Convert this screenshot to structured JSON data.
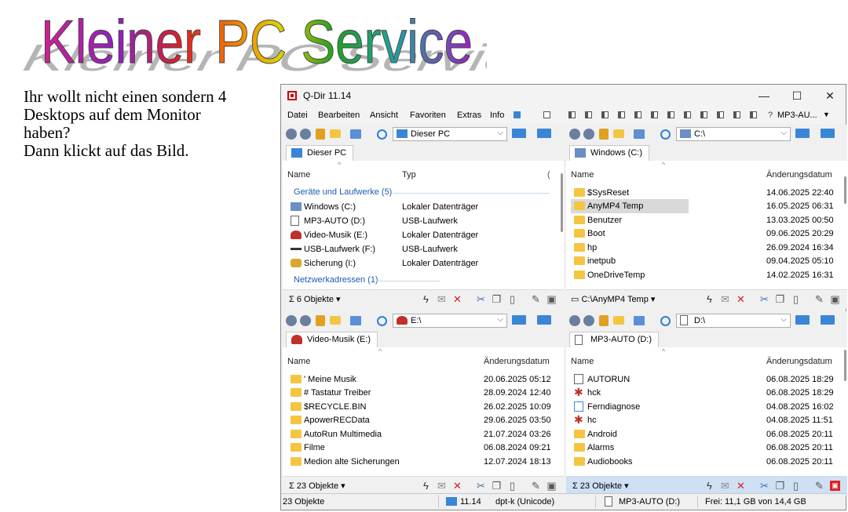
{
  "banner": {
    "text": "Kleiner PC Service"
  },
  "intro": {
    "lines": [
      "Ihr wollt nicht einen sondern 4",
      "Desktops auf dem Monitor",
      "haben?",
      "Dann klickt auf das Bild."
    ]
  },
  "window": {
    "title": "Q-Dir 11.14",
    "controls": {
      "minimize": "—",
      "maximize": "☐",
      "close": "✕"
    },
    "menu": [
      "Datei",
      "Bearbeiten",
      "Ansicht",
      "Favoriten",
      "Extras",
      "Info"
    ],
    "menu_right_label": "MP3-AU..."
  },
  "panes": [
    {
      "address": "Dieser PC",
      "tab": "Dieser PC",
      "columns": [
        "Name",
        "Typ",
        "("
      ],
      "groups": [
        "Geräte und Laufwerke (5)",
        "Netzwerkadressen (1)"
      ],
      "rows": [
        {
          "name": "Windows (C:)",
          "type": "Lokaler Datenträger"
        },
        {
          "name": "MP3-AUTO (D:)",
          "type": "USB-Laufwerk"
        },
        {
          "name": "Video-Musik (E:)",
          "type": "Lokaler Datenträger"
        },
        {
          "name": "USB-Laufwerk (F:)",
          "type": "USB-Laufwerk"
        },
        {
          "name": "Sicherung (I:)",
          "type": "Lokaler Datenträger"
        }
      ],
      "status": "6 Objekte"
    },
    {
      "address": "C:\\",
      "tab": "Windows (C:)",
      "columns": [
        "Name",
        "Änderungsdatum"
      ],
      "rows": [
        {
          "name": "$SysReset",
          "date": "14.06.2025 22:40"
        },
        {
          "name": "AnyMP4 Temp",
          "date": "16.05.2025 06:31"
        },
        {
          "name": "Benutzer",
          "date": "13.03.2025 00:50"
        },
        {
          "name": "Boot",
          "date": "09.06.2025 20:29"
        },
        {
          "name": "hp",
          "date": "26.09.2024 16:34"
        },
        {
          "name": "inetpub",
          "date": "09.04.2025 05:10"
        },
        {
          "name": "OneDriveTemp",
          "date": "14.02.2025 16:31"
        }
      ],
      "status": "C:\\AnyMP4 Temp"
    },
    {
      "address": "E:\\",
      "tab": "Video-Musik (E:)",
      "columns": [
        "Name",
        "Änderungsdatum"
      ],
      "rows": [
        {
          "name": "' Meine Musik",
          "date": "20.06.2025 05:12"
        },
        {
          "name": "# Tastatur Treiber",
          "date": "28.09.2024 12:40"
        },
        {
          "name": "$RECYCLE.BIN",
          "date": "26.02.2025 10:09"
        },
        {
          "name": "ApowerRECData",
          "date": "29.06.2025 03:50"
        },
        {
          "name": "AutoRun Multimedia",
          "date": "21.07.2024 03:26"
        },
        {
          "name": "Filme",
          "date": "06.08.2024 09:21"
        },
        {
          "name": "Medion alte Sicherungen",
          "date": "12.07.2024 18:13"
        }
      ],
      "status": "23 Objekte"
    },
    {
      "address": "D:\\",
      "tab": "MP3-AUTO (D:)",
      "columns": [
        "Name",
        "Änderungsdatum"
      ],
      "rows": [
        {
          "name": "AUTORUN",
          "date": "06.08.2025 18:29"
        },
        {
          "name": "hck",
          "date": "06.08.2025 18:29"
        },
        {
          "name": "Ferndiagnose",
          "date": "04.08.2025 16:02"
        },
        {
          "name": "hc",
          "date": "04.08.2025 11:51"
        },
        {
          "name": "Android",
          "date": "06.08.2025 20:11"
        },
        {
          "name": "Alarms",
          "date": "06.08.2025 20:11"
        },
        {
          "name": "Audiobooks",
          "date": "06.08.2025 20:11"
        }
      ],
      "status": "23 Objekte"
    }
  ],
  "statusbar": {
    "count": "23 Objekte",
    "version": "11.14",
    "encoding": "dpt-k (Unicode)",
    "drive": "MP3-AUTO (D:)",
    "free": "Frei: 11,1 GB von 14,4 GB"
  },
  "colors": {
    "selection": "#d9d9d9",
    "active_status": "#cfe0f5",
    "group_text": "#1c5cb0",
    "folder": "#f5c542"
  }
}
